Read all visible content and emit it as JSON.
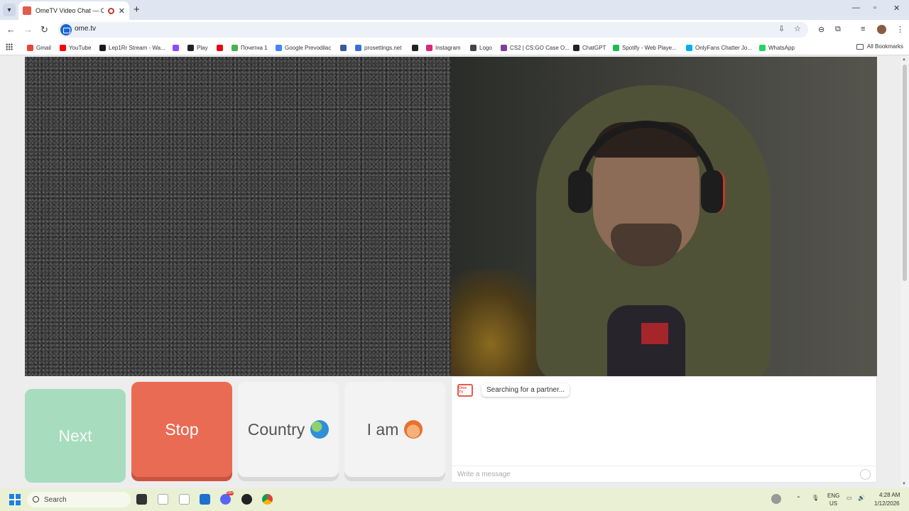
{
  "browser": {
    "tab_title": "OmeTV Video Chat — Ome",
    "new_tab": "+",
    "url": "ome.tv"
  },
  "bookmarks": [
    {
      "label": "Gmail",
      "color": "#ea4335"
    },
    {
      "label": "YouTube",
      "color": "#ff0000"
    },
    {
      "label": "Lep1Rr Stream - Wa...",
      "color": "#1a1a1a"
    },
    {
      "label": "",
      "color": "#9146ff"
    },
    {
      "label": "Play",
      "color": "#222222"
    },
    {
      "label": "",
      "color": "#e50914"
    },
    {
      "label": "Почетна 1",
      "color": "#4caf50"
    },
    {
      "label": "Google Prevodilac",
      "color": "#4285f4"
    },
    {
      "label": "",
      "color": "#3b5998"
    },
    {
      "label": "prosettings.net",
      "color": "#3b6fd8"
    },
    {
      "label": "",
      "color": "#222222"
    },
    {
      "label": "Instagram",
      "color": "#d62976"
    },
    {
      "label": "Logo",
      "color": "#444444"
    },
    {
      "label": "CS2 | CS:GO Case O...",
      "color": "#7b3fa0"
    },
    {
      "label": "ChatGPT",
      "color": "#222222"
    },
    {
      "label": "Spotify - Web Playe...",
      "color": "#1db954"
    },
    {
      "label": "OnlyFans Chatter Jo...",
      "color": "#00aff0"
    },
    {
      "label": "WhatsApp",
      "color": "#25d366"
    }
  ],
  "all_bookmarks": "All Bookmarks",
  "controls": {
    "next": "Next",
    "stop": "Stop",
    "country": "Country",
    "iam": "I am"
  },
  "chat": {
    "logo": "Ome TV",
    "status": "Searching for a partner...",
    "input_placeholder": "Write a message"
  },
  "taskbar": {
    "search_placeholder": "Search",
    "lang_top": "ENG",
    "lang_bottom": "US",
    "time": "4:28 AM",
    "date": "1/12/2026",
    "badge": "99+"
  }
}
